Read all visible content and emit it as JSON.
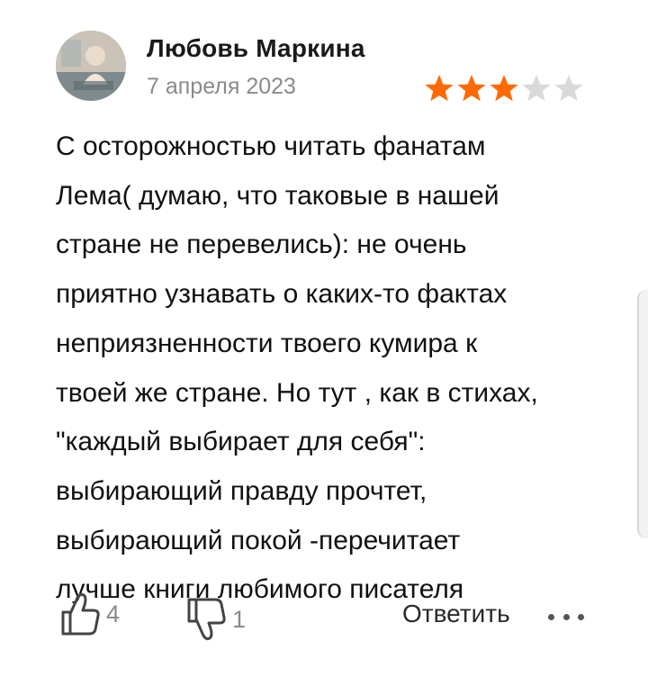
{
  "review": {
    "author_name": "Любовь Маркина",
    "date": "7 апреля 2023",
    "rating": 3,
    "rating_max": 5,
    "colors": {
      "star_filled": "#ff6a00",
      "star_empty": "#d9d9d9",
      "text": "#111111",
      "secondary": "#8a8a8a"
    },
    "text_lines": [
      "С осторожностью читать фанатам",
      "Лема( думаю, что таковые в нашей",
      "стране не перевелись): не очень",
      "приятно узнавать о каких-то фактах",
      "неприязненности твоего кумира к",
      "твоей же стране. Но тут , как в стихах,",
      "\"каждый выбирает для себя\":",
      "выбирающий правду прочтет,",
      "выбирающий покой -перечитает",
      "лучше книги любимого писателя"
    ]
  },
  "actions": {
    "like_icon": "thumbs-up-icon",
    "like_count": "4",
    "dislike_icon": "thumbs-down-icon",
    "dislike_count": "1",
    "reply_label": "Ответить",
    "more_icon": "more-dots-icon"
  }
}
